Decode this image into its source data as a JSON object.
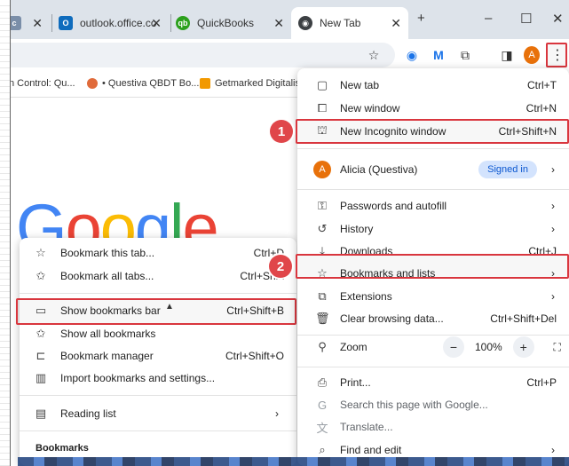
{
  "tabs": [
    {
      "label": "",
      "favicon": "generic-icon",
      "active": false
    },
    {
      "label": "outlook.office.co",
      "favicon": "outlook-icon",
      "active": false
    },
    {
      "label": "QuickBooks",
      "favicon": "quickbooks-icon",
      "active": false
    },
    {
      "label": "New Tab",
      "favicon": "chrome-icon",
      "active": true
    }
  ],
  "window_controls": {
    "new_tab": "+",
    "minimize": "–",
    "maximize": "☐",
    "close": "✕"
  },
  "toolbar": {
    "profile_initial": "A",
    "menu_glyph": "⋮"
  },
  "bookmarks_bar": [
    {
      "label": "n Control: Qu..."
    },
    {
      "label": "• Questiva QBDT Bo..."
    },
    {
      "label": "Getmarked Digitalis..."
    }
  ],
  "main_menu": {
    "new_tab": {
      "label": "New tab",
      "shortcut": "Ctrl+T"
    },
    "new_window": {
      "label": "New window",
      "shortcut": "Ctrl+N"
    },
    "new_incognito": {
      "label": "New Incognito window",
      "shortcut": "Ctrl+Shift+N"
    },
    "profile": {
      "initial": "A",
      "name": "Alicia (Questiva)",
      "status": "Signed in"
    },
    "passwords": {
      "label": "Passwords and autofill"
    },
    "history": {
      "label": "History"
    },
    "downloads": {
      "label": "Downloads",
      "shortcut": "Ctrl+J"
    },
    "bookmarks": {
      "label": "Bookmarks and lists"
    },
    "extensions": {
      "label": "Extensions"
    },
    "clear": {
      "label": "Clear browsing data...",
      "shortcut": "Ctrl+Shift+Del"
    },
    "zoom": {
      "label": "Zoom",
      "minus": "−",
      "value": "100%",
      "plus": "+"
    },
    "print": {
      "label": "Print...",
      "shortcut": "Ctrl+P"
    },
    "search_page": {
      "label": "Search this page with Google..."
    },
    "translate": {
      "label": "Translate..."
    },
    "find_edit": {
      "label": "Find and edit"
    }
  },
  "bookmarks_submenu": {
    "bookmark_tab": {
      "label": "Bookmark this tab...",
      "shortcut": "Ctrl+D"
    },
    "bookmark_all": {
      "label": "Bookmark all tabs...",
      "shortcut": "Ctrl+Shift"
    },
    "show_bar": {
      "label": "Show bookmarks bar",
      "shortcut": "Ctrl+Shift+B"
    },
    "show_all": {
      "label": "Show all bookmarks"
    },
    "manager": {
      "label": "Bookmark manager",
      "shortcut": "Ctrl+Shift+O"
    },
    "import": {
      "label": "Import bookmarks and settings..."
    },
    "reading_list": {
      "label": "Reading list"
    },
    "section_label": "Bookmarks"
  },
  "callouts": {
    "step1": "1",
    "step2": "2"
  },
  "google_logo": "Google",
  "colors": {
    "highlight": "#d9363e",
    "callout": "#e0464a",
    "signed_in_bg": "#d3e3fd",
    "avatar": "#e8710a"
  }
}
